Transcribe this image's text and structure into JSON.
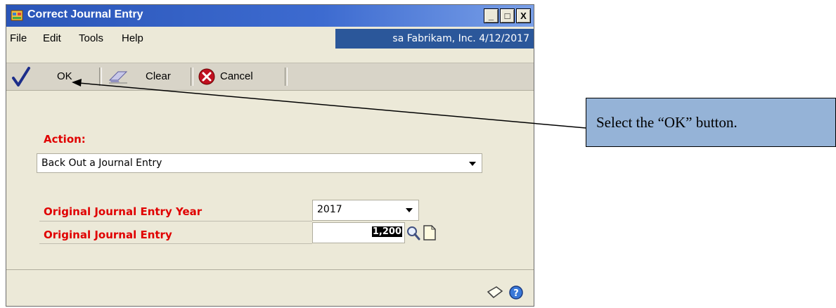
{
  "window": {
    "title": "Correct Journal Entry",
    "controls": {
      "minimize": "_",
      "maximize": "□",
      "close": "X"
    }
  },
  "menu": {
    "items": [
      {
        "label": "File"
      },
      {
        "label": "Edit"
      },
      {
        "label": "Tools"
      },
      {
        "label": "Help"
      }
    ],
    "user_info": "sa  Fabrikam, Inc.  4/12/2017"
  },
  "toolbar": {
    "ok_label": "OK",
    "clear_label": "Clear",
    "cancel_label": "Cancel"
  },
  "form": {
    "action_label": "Action:",
    "action_value": "Back Out a Journal Entry",
    "year_label": "Original Journal Entry Year",
    "year_value": "2017",
    "entry_label": "Original Journal Entry",
    "entry_value": "1,200"
  },
  "callout": {
    "text": "Select the “OK” button."
  },
  "colors": {
    "titlebar": "#2a55b8",
    "userinfo_bg": "#2b579a",
    "required_label": "#e00000",
    "callout_bg": "#95b3d7",
    "window_bg": "#ece9d8"
  },
  "icons": [
    "app-icon",
    "checkmark-icon",
    "eraser-icon",
    "cancel-icon",
    "lookup-magnifier-icon",
    "new-document-icon",
    "note-icon",
    "help-icon"
  ]
}
